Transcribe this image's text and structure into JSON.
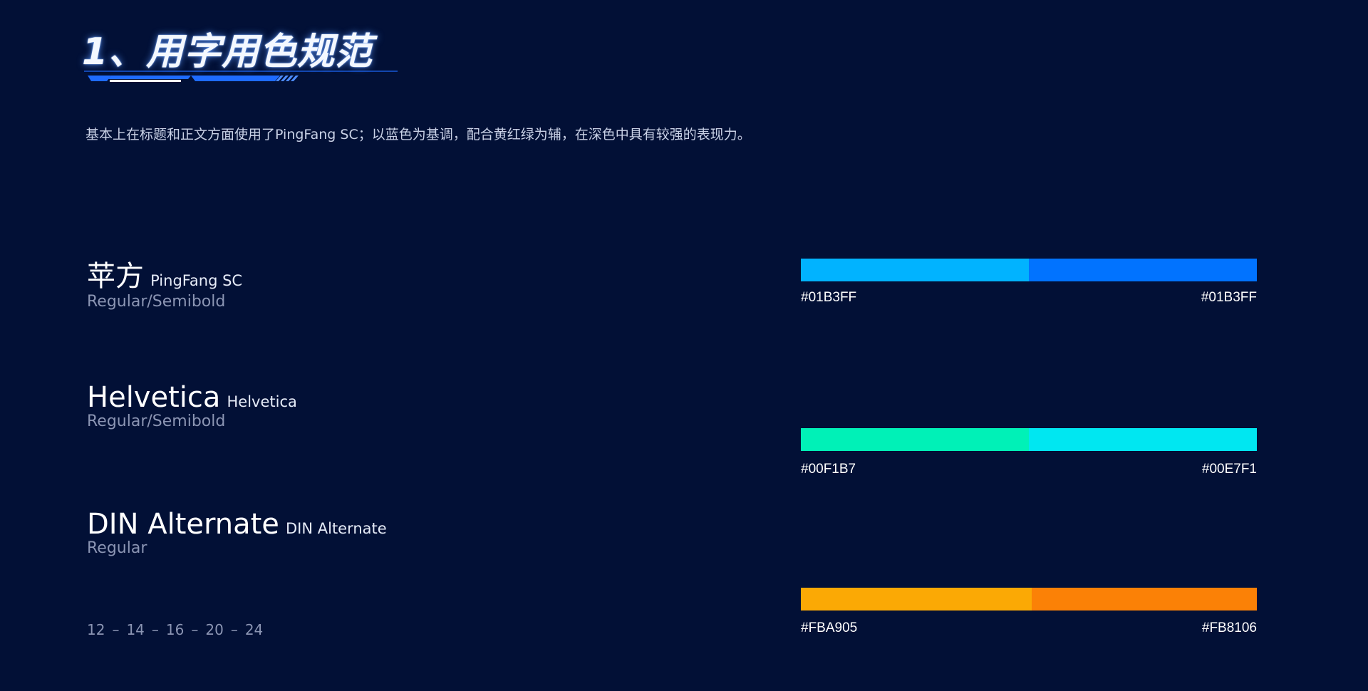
{
  "title": "1、用字用色规范",
  "description": "基本上在标题和正文方面使用了PingFang SC；以蓝色为基调，配合黄红绿为辅，在深色中具有较强的表现力。",
  "fonts": [
    {
      "name": "苹方",
      "sub": "PingFang SC",
      "weights": "Regular/Semibold"
    },
    {
      "name": "Helvetica",
      "sub": "Helvetica",
      "weights": "Regular/Semibold"
    },
    {
      "name": "DIN Alternate",
      "sub": "DIN Alternate",
      "weights": "Regular"
    }
  ],
  "sizes": [
    "12",
    "14",
    "16",
    "20",
    "24"
  ],
  "size_separator": "–",
  "color_bars": [
    {
      "left_label": "#01B3FF",
      "right_label": "#01B3FF",
      "left_color": "#01B3FF",
      "right_color": "#0173FF"
    },
    {
      "left_label": "#00F1B7",
      "right_label": "#00E7F1",
      "left_color": "#00F1B7",
      "right_color": "#00E7F1"
    },
    {
      "left_label": "#FBA905",
      "right_label": "#FB8106",
      "left_color": "#FBA905",
      "right_color": "#FB8106"
    }
  ],
  "colors": {
    "background": "#021036",
    "title_glow": "#5A96FF",
    "accent_blue": "#1E6BFF"
  }
}
